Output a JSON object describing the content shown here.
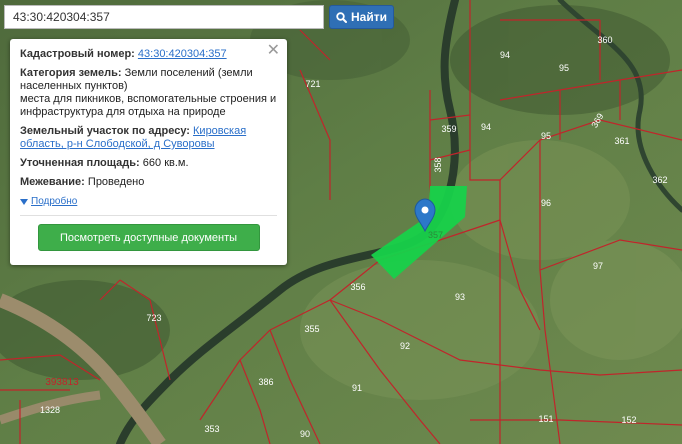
{
  "search": {
    "value": "43:30:420304:357",
    "button_label": "Найти"
  },
  "popup": {
    "cadastral_label": "Кадастровый номер:",
    "cadastral_value": "43:30:420304:357",
    "category_label": "Категория земель:",
    "category_value_1": "Земли поселений (земли населенных пунктов)",
    "category_value_2": "места для пикников, вспомогательные строения и инфраструктура для отдыха на природе",
    "address_label": "Земельный участок по адресу:",
    "address_value": "Кировская область, р-н Слободской, д Суворовы",
    "area_label": "Уточненная площадь:",
    "area_value": "660 кв.м.",
    "survey_label": "Межевание:",
    "survey_value": "Проведено",
    "more_label": "Подробно",
    "docs_button": "Посмотреть доступные документы",
    "close_glyph": "✕"
  },
  "map": {
    "parcel_labels": [
      "360",
      "94",
      "95",
      "369",
      "721",
      "359",
      "94",
      "95",
      "361",
      "358",
      "362",
      "96",
      "357",
      "97",
      "356",
      "93",
      "723",
      "355",
      "92",
      "386",
      "91",
      "393813",
      "1328",
      "353",
      "90",
      "151",
      "152"
    ],
    "selected_parcel": "357",
    "colors": {
      "parcel_border": "#c0252b",
      "selected_fill": "#17d14a",
      "marker": "#2c78c9",
      "river": "#2a3d2c",
      "road": "#9c8c6c"
    }
  }
}
